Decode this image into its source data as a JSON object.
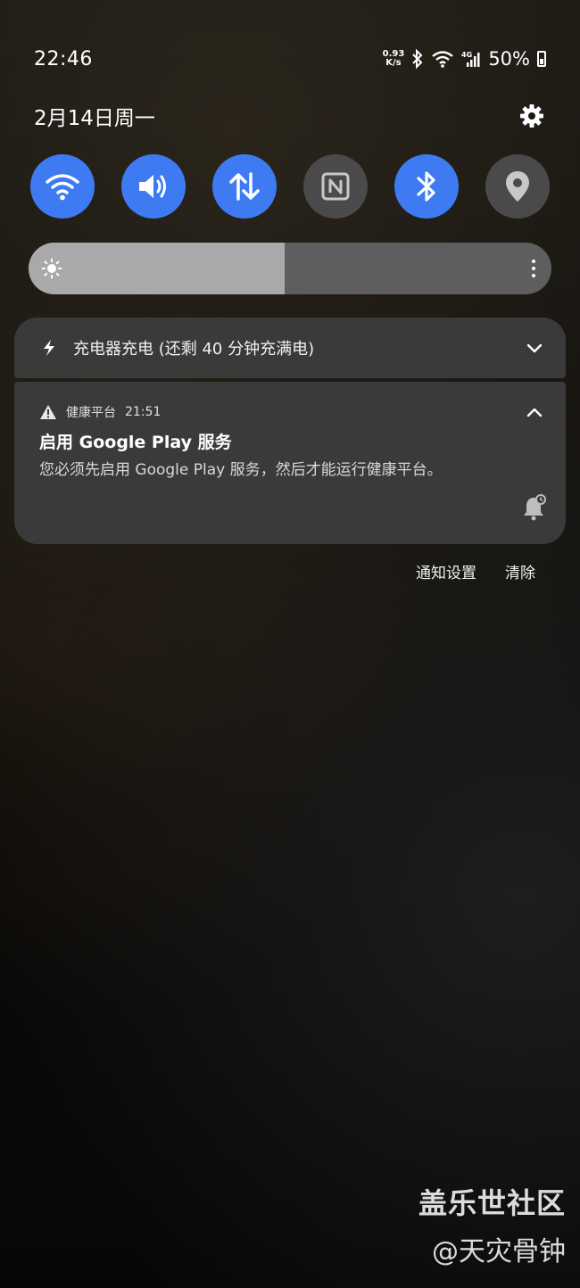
{
  "status": {
    "time": "22:46",
    "net_speed_value": "0.93",
    "net_speed_unit": "K/s",
    "battery": "50%"
  },
  "date_text": "2月14日周一",
  "quick_toggles": [
    {
      "name": "wifi",
      "icon": "wifi-icon",
      "on": true
    },
    {
      "name": "sound",
      "icon": "volume-icon",
      "on": true
    },
    {
      "name": "mobile-data",
      "icon": "data-arrows-icon",
      "on": true
    },
    {
      "name": "nfc",
      "icon": "nfc-icon",
      "on": false
    },
    {
      "name": "bluetooth",
      "icon": "bluetooth-icon",
      "on": true
    },
    {
      "name": "location",
      "icon": "location-icon",
      "on": false
    }
  ],
  "brightness": {
    "level_fraction": 0.49
  },
  "charging": {
    "text": "充电器充电 (还剩 40 分钟充满电)"
  },
  "notification": {
    "app": "健康平台",
    "time": "21:51",
    "title": "启用 Google Play 服务",
    "body": "您必须先启用 Google Play 服务，然后才能运行健康平台。"
  },
  "actions": {
    "settings": "通知设置",
    "clear": "清除"
  },
  "watermark": {
    "title": "盖乐世社区",
    "user": "@天灾骨钟"
  },
  "colors": {
    "toggle_on": "#3e7bf3",
    "toggle_off": "#4a4a4a",
    "card": "#3a3a3a"
  }
}
